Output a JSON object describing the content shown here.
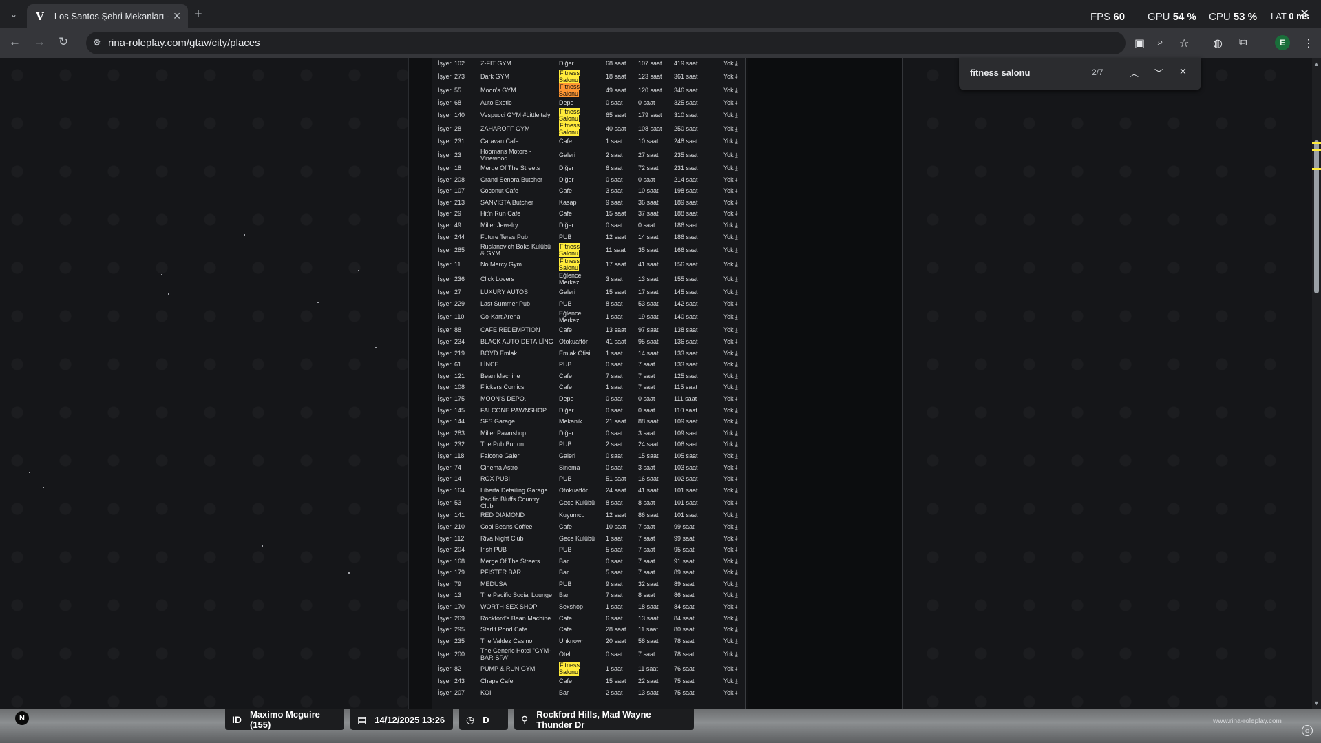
{
  "browser": {
    "tab_title": "Los Santos Şehri Mekanları - Ri",
    "url": "rina-roleplay.com/gtav/city/places",
    "profile_initial": "E"
  },
  "hud": {
    "fps_label": "FPS",
    "fps_value": "60",
    "gpu_label": "GPU",
    "gpu_value": "54 %",
    "cpu_label": "CPU",
    "cpu_value": "53 %",
    "lat_label": "LAT",
    "lat_value": "0 ms"
  },
  "find": {
    "query": "fitness salonu",
    "count": "2/7"
  },
  "rows": [
    {
      "id": "İşyeri 102",
      "name": "Z-FIT GYM",
      "type": "Diğer",
      "a": "68 saat",
      "b": "107 saat",
      "c": "419 saat",
      "d": "Yok",
      "hl": ""
    },
    {
      "id": "İşyeri 273",
      "name": "Dark GYM",
      "type": "Fitness Salonu",
      "a": "18 saat",
      "b": "123 saat",
      "c": "361 saat",
      "d": "Yok",
      "hl": "yes"
    },
    {
      "id": "İşyeri 55",
      "name": "Moon's GYM",
      "type": "Fitness Salonu",
      "a": "49 saat",
      "b": "120 saat",
      "c": "346 saat",
      "d": "Yok",
      "hl": "active"
    },
    {
      "id": "İşyeri 68",
      "name": "Auto Exotic",
      "type": "Depo",
      "a": "0 saat",
      "b": "0 saat",
      "c": "325 saat",
      "d": "Yok",
      "hl": ""
    },
    {
      "id": "İşyeri 140",
      "name": "Vespucci GYM #Littleitaly",
      "type": "Fitness Salonu",
      "a": "65 saat",
      "b": "179 saat",
      "c": "310 saat",
      "d": "Yok",
      "hl": "yes"
    },
    {
      "id": "İşyeri 28",
      "name": "ZAHAROFF GYM",
      "type": "Fitness Salonu",
      "a": "40 saat",
      "b": "108 saat",
      "c": "250 saat",
      "d": "Yok",
      "hl": "yes"
    },
    {
      "id": "İşyeri 231",
      "name": "Caravan Cafe",
      "type": "Cafe",
      "a": "1 saat",
      "b": "10 saat",
      "c": "248 saat",
      "d": "Yok",
      "hl": ""
    },
    {
      "id": "İşyeri 23",
      "name": "Hoomans Motors - Vinewood",
      "type": "Galeri",
      "a": "2 saat",
      "b": "27 saat",
      "c": "235 saat",
      "d": "Yok",
      "hl": "",
      "tall": true
    },
    {
      "id": "İşyeri 18",
      "name": "Merge Of The Streets",
      "type": "Diğer",
      "a": "6 saat",
      "b": "72 saat",
      "c": "231 saat",
      "d": "Yok",
      "hl": ""
    },
    {
      "id": "İşyeri 208",
      "name": "Grand Senora Butcher",
      "type": "Diğer",
      "a": "0 saat",
      "b": "0 saat",
      "c": "214 saat",
      "d": "Yok",
      "hl": ""
    },
    {
      "id": "İşyeri 107",
      "name": "Coconut Cafe",
      "type": "Cafe",
      "a": "3 saat",
      "b": "10 saat",
      "c": "198 saat",
      "d": "Yok",
      "hl": ""
    },
    {
      "id": "İşyeri 213",
      "name": "SANVISTA Butcher",
      "type": "Kasap",
      "a": "9 saat",
      "b": "36 saat",
      "c": "189 saat",
      "d": "Yok",
      "hl": ""
    },
    {
      "id": "İşyeri 29",
      "name": "Hit'n Run Cafe",
      "type": "Cafe",
      "a": "15 saat",
      "b": "37 saat",
      "c": "188 saat",
      "d": "Yok",
      "hl": ""
    },
    {
      "id": "İşyeri 49",
      "name": "Miller Jewelry",
      "type": "Diğer",
      "a": "0 saat",
      "b": "0 saat",
      "c": "186 saat",
      "d": "Yok",
      "hl": ""
    },
    {
      "id": "İşyeri 244",
      "name": "Future Teras Pub",
      "type": "PUB",
      "a": "12 saat",
      "b": "14 saat",
      "c": "186 saat",
      "d": "Yok",
      "hl": ""
    },
    {
      "id": "İşyeri 285",
      "name": "Ruslanovich Boks Kulübü & GYM",
      "type": "Fitness Salonu",
      "a": "11 saat",
      "b": "35 saat",
      "c": "166 saat",
      "d": "Yok",
      "hl": "yes",
      "tall": true
    },
    {
      "id": "İşyeri 11",
      "name": "No Mercy Gym",
      "type": "Fitness Salonu",
      "a": "17 saat",
      "b": "41 saat",
      "c": "156 saat",
      "d": "Yok",
      "hl": "yes"
    },
    {
      "id": "İşyeri 236",
      "name": "Click Lovers",
      "type": "Eğlence Merkezi",
      "a": "3 saat",
      "b": "13 saat",
      "c": "155 saat",
      "d": "Yok",
      "hl": "",
      "tall": true
    },
    {
      "id": "İşyeri 27",
      "name": "LUXURY AUTOS",
      "type": "Galeri",
      "a": "15 saat",
      "b": "17 saat",
      "c": "145 saat",
      "d": "Yok",
      "hl": ""
    },
    {
      "id": "İşyeri 229",
      "name": "Last Summer Pub",
      "type": "PUB",
      "a": "8 saat",
      "b": "53 saat",
      "c": "142 saat",
      "d": "Yok",
      "hl": ""
    },
    {
      "id": "İşyeri 110",
      "name": "Go-Kart Arena",
      "type": "Eğlence Merkezi",
      "a": "1 saat",
      "b": "19 saat",
      "c": "140 saat",
      "d": "Yok",
      "hl": "",
      "tall": true
    },
    {
      "id": "İşyeri 88",
      "name": "CAFE REDEMPTION",
      "type": "Cafe",
      "a": "13 saat",
      "b": "97 saat",
      "c": "138 saat",
      "d": "Yok",
      "hl": ""
    },
    {
      "id": "İşyeri 234",
      "name": "BLACK AUTO DETAİLİNG",
      "type": "Otokuafför",
      "a": "41 saat",
      "b": "95 saat",
      "c": "136 saat",
      "d": "Yok",
      "hl": ""
    },
    {
      "id": "İşyeri 219",
      "name": "BOYD Emlak",
      "type": "Emlak Ofisi",
      "a": "1 saat",
      "b": "14 saat",
      "c": "133 saat",
      "d": "Yok",
      "hl": ""
    },
    {
      "id": "İşyeri 61",
      "name": "LİNCE",
      "type": "PUB",
      "a": "0 saat",
      "b": "7 saat",
      "c": "133 saat",
      "d": "Yok",
      "hl": ""
    },
    {
      "id": "İşyeri 121",
      "name": "Bean Machine",
      "type": "Cafe",
      "a": "7 saat",
      "b": "7 saat",
      "c": "125 saat",
      "d": "Yok",
      "hl": ""
    },
    {
      "id": "İşyeri 108",
      "name": "Flickers Comics",
      "type": "Cafe",
      "a": "1 saat",
      "b": "7 saat",
      "c": "115 saat",
      "d": "Yok",
      "hl": ""
    },
    {
      "id": "İşyeri 175",
      "name": "MOON'S DEPO.",
      "type": "Depo",
      "a": "0 saat",
      "b": "0 saat",
      "c": "111 saat",
      "d": "Yok",
      "hl": ""
    },
    {
      "id": "İşyeri 145",
      "name": "FALCONE PAWNSHOP",
      "type": "Diğer",
      "a": "0 saat",
      "b": "0 saat",
      "c": "110 saat",
      "d": "Yok",
      "hl": ""
    },
    {
      "id": "İşyeri 144",
      "name": "SFS Garage",
      "type": "Mekanik",
      "a": "21 saat",
      "b": "88 saat",
      "c": "109 saat",
      "d": "Yok",
      "hl": ""
    },
    {
      "id": "İşyeri 283",
      "name": "Miller Pawnshop",
      "type": "Diğer",
      "a": "0 saat",
      "b": "3 saat",
      "c": "109 saat",
      "d": "Yok",
      "hl": ""
    },
    {
      "id": "İşyeri 232",
      "name": "The Pub Burton",
      "type": "PUB",
      "a": "2 saat",
      "b": "24 saat",
      "c": "106 saat",
      "d": "Yok",
      "hl": ""
    },
    {
      "id": "İşyeri 118",
      "name": "Falcone Galeri",
      "type": "Galeri",
      "a": "0 saat",
      "b": "15 saat",
      "c": "105 saat",
      "d": "Yok",
      "hl": ""
    },
    {
      "id": "İşyeri 74",
      "name": "Cinema Astro",
      "type": "Sinema",
      "a": "0 saat",
      "b": "3 saat",
      "c": "103 saat",
      "d": "Yok",
      "hl": ""
    },
    {
      "id": "İşyeri 14",
      "name": "ROX PUBI",
      "type": "PUB",
      "a": "51 saat",
      "b": "16 saat",
      "c": "102 saat",
      "d": "Yok",
      "hl": ""
    },
    {
      "id": "İşyeri 164",
      "name": "Liberta Detailing Garage",
      "type": "Otokuafför",
      "a": "24 saat",
      "b": "41 saat",
      "c": "101 saat",
      "d": "Yok",
      "hl": ""
    },
    {
      "id": "İşyeri 53",
      "name": "Pacific Bluffs Country Club",
      "type": "Gece Kulübü",
      "a": "8 saat",
      "b": "8 saat",
      "c": "101 saat",
      "d": "Yok",
      "hl": ""
    },
    {
      "id": "İşyeri 141",
      "name": "RED DIAMOND",
      "type": "Kuyumcu",
      "a": "12 saat",
      "b": "86 saat",
      "c": "101 saat",
      "d": "Yok",
      "hl": ""
    },
    {
      "id": "İşyeri 210",
      "name": "Cool Beans Coffee",
      "type": "Cafe",
      "a": "10 saat",
      "b": "7 saat",
      "c": "99 saat",
      "d": "Yok",
      "hl": ""
    },
    {
      "id": "İşyeri 112",
      "name": "Riva Night Club",
      "type": "Gece Kulübü",
      "a": "1 saat",
      "b": "7 saat",
      "c": "99 saat",
      "d": "Yok",
      "hl": ""
    },
    {
      "id": "İşyeri 204",
      "name": "Irish PUB",
      "type": "PUB",
      "a": "5 saat",
      "b": "7 saat",
      "c": "95 saat",
      "d": "Yok",
      "hl": ""
    },
    {
      "id": "İşyeri 168",
      "name": "Merge Of The Streets",
      "type": "Bar",
      "a": "0 saat",
      "b": "7 saat",
      "c": "91 saat",
      "d": "Yok",
      "hl": ""
    },
    {
      "id": "İşyeri 179",
      "name": "PFISTER BAR",
      "type": "Bar",
      "a": "5 saat",
      "b": "7 saat",
      "c": "89 saat",
      "d": "Yok",
      "hl": ""
    },
    {
      "id": "İşyeri 79",
      "name": "MEDUSA",
      "type": "PUB",
      "a": "9 saat",
      "b": "32 saat",
      "c": "89 saat",
      "d": "Yok",
      "hl": ""
    },
    {
      "id": "İşyeri 13",
      "name": "The Pacific Social Lounge",
      "type": "Bar",
      "a": "7 saat",
      "b": "8 saat",
      "c": "86 saat",
      "d": "Yok",
      "hl": ""
    },
    {
      "id": "İşyeri 170",
      "name": "WORTH SEX SHOP",
      "type": "Sexshop",
      "a": "1 saat",
      "b": "18 saat",
      "c": "84 saat",
      "d": "Yok",
      "hl": ""
    },
    {
      "id": "İşyeri 269",
      "name": "Rockford's Bean Machine",
      "type": "Cafe",
      "a": "6 saat",
      "b": "13 saat",
      "c": "84 saat",
      "d": "Yok",
      "hl": ""
    },
    {
      "id": "İşyeri 295",
      "name": "Starlit Pond Cafe",
      "type": "Cafe",
      "a": "28 saat",
      "b": "11 saat",
      "c": "80 saat",
      "d": "Yok",
      "hl": ""
    },
    {
      "id": "İşyeri 235",
      "name": "The Valdez Casino",
      "type": "Unknown",
      "a": "20 saat",
      "b": "58 saat",
      "c": "78 saat",
      "d": "Yok",
      "hl": ""
    },
    {
      "id": "İşyeri 200",
      "name": "The Generic Hotel \"GYM-BAR-SPA\"",
      "type": "Otel",
      "a": "0 saat",
      "b": "7 saat",
      "c": "78 saat",
      "d": "Yok",
      "hl": "",
      "tall": true
    },
    {
      "id": "İşyeri 82",
      "name": "PUMP & RUN GYM",
      "type": "Fitness Salonu",
      "a": "1 saat",
      "b": "11 saat",
      "c": "76 saat",
      "d": "Yok",
      "hl": "yes"
    },
    {
      "id": "İşyeri 243",
      "name": "Chaps Cafe",
      "type": "Cafe",
      "a": "15 saat",
      "b": "22 saat",
      "c": "75 saat",
      "d": "Yok",
      "hl": ""
    },
    {
      "id": "İşyeri 207",
      "name": "KOI",
      "type": "Bar",
      "a": "2 saat",
      "b": "13 saat",
      "c": "75 saat",
      "d": "Yok",
      "hl": ""
    }
  ],
  "game": {
    "id_label": "ID",
    "player": "Maximo Mcguire (155)",
    "datetime": "14/12/2025 13:26",
    "direction": "D",
    "location": "Rockford Hills, Mad Wayne Thunder Dr",
    "watermark": "www.rina-roleplay.com",
    "n_logo": "N"
  }
}
